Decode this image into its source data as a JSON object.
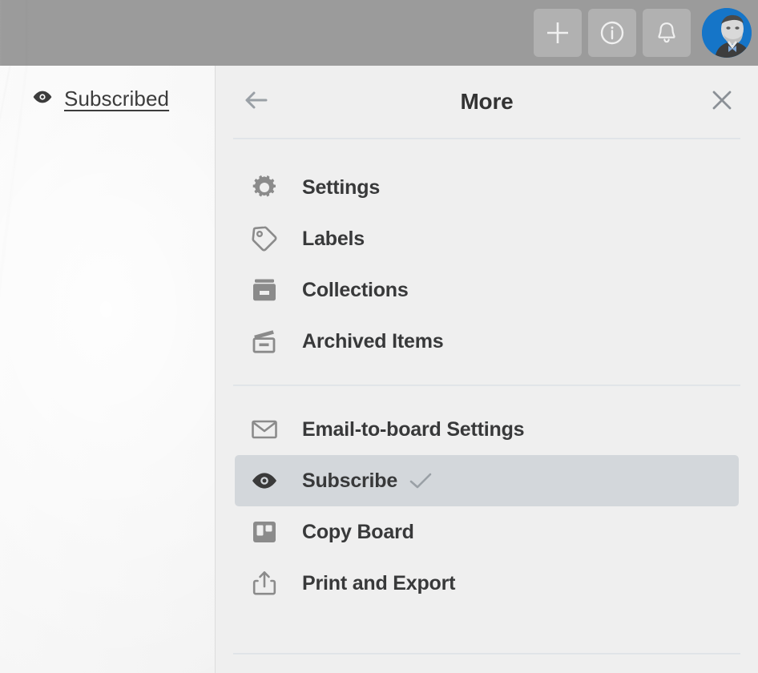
{
  "topbar": {
    "background_color": "#9b9b9b",
    "actions": [
      {
        "name": "add-button",
        "icon": "plus-icon",
        "label": "Add"
      },
      {
        "name": "info-button",
        "icon": "info-icon",
        "label": "Information"
      },
      {
        "name": "notifications-button",
        "icon": "bell-icon",
        "label": "Notifications"
      }
    ],
    "avatar": {
      "name": "user-avatar",
      "background_color": "#1575c8",
      "label": "User profile"
    }
  },
  "board": {
    "subscribed_chip": {
      "icon": "eye-icon",
      "label": "Subscribed"
    }
  },
  "panel": {
    "background_color": "#efefef",
    "header": {
      "back_label": "Back",
      "back_icon": "arrow-left-icon",
      "title": "More",
      "close_label": "Close",
      "close_icon": "close-icon"
    },
    "groups": [
      {
        "name": "board-settings-group",
        "items": [
          {
            "icon": "gear-icon",
            "label": "Settings",
            "active": false,
            "checked": false
          },
          {
            "icon": "tag-icon",
            "label": "Labels",
            "active": false,
            "checked": false
          },
          {
            "icon": "collections-icon",
            "label": "Collections",
            "active": false,
            "checked": false
          },
          {
            "icon": "archive-icon",
            "label": "Archived Items",
            "active": false,
            "checked": false
          }
        ]
      },
      {
        "name": "board-actions-group",
        "items": [
          {
            "icon": "envelope-icon",
            "label": "Email-to-board Settings",
            "active": false,
            "checked": false
          },
          {
            "icon": "eye-icon",
            "label": "Subscribe",
            "active": true,
            "checked": true
          },
          {
            "icon": "board-icon",
            "label": "Copy Board",
            "active": false,
            "checked": false
          },
          {
            "icon": "share-icon",
            "label": "Print and Export",
            "active": false,
            "checked": false
          }
        ]
      }
    ],
    "highlight_color": "#d3d7db",
    "divider_color": "#e2e6ea"
  }
}
